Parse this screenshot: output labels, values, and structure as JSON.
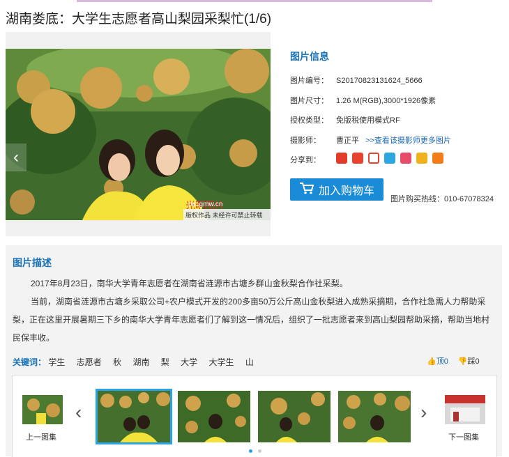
{
  "title": "湖南娄底：大学生志愿者高山梨园采梨忙(1/6)",
  "photo": {
    "watermark_site": "pic.gmw.cn",
    "copyright_note": "版权作品  未经许可禁止转载"
  },
  "info": {
    "heading": "图片信息",
    "id_label": "图片编号：",
    "id_value": "S20170823131624_5666",
    "size_label": "图片尺寸：",
    "size_value": "1.26 M(RGB),3000*1926像素",
    "license_label": "授权类型：",
    "license_value": "免版税使用模式RF",
    "photographer_label": "摄影师：",
    "photographer_value": "曹正平",
    "photographer_link": ">>查看该摄影师更多图片",
    "share_label": "分享到："
  },
  "cart_button": "加入购物车",
  "hotline": "图片购买热线：010-67078324",
  "description": {
    "heading": "图片描述",
    "paragraphs": [
      "2017年8月23日，南华大学青年志愿者在湖南省涟源市古塘乡群山金秋梨合作社采梨。",
      "当前，湖南省涟源市古塘乡采取公司+农户模式开发的200多亩50万公斤高山金秋梨进入成熟采摘期，合作社急需人力帮助采梨，正在这里开展暑期三下乡的南华大学青年志愿者们了解到这一情况后，组织了一批志愿者来到高山梨园帮助采摘，帮助当地村民保丰收。"
    ]
  },
  "keywords": {
    "label": "关键词：",
    "items": [
      "学生",
      "志愿者",
      "秋",
      "湖南",
      "梨",
      "大学",
      "大学生",
      "山"
    ]
  },
  "votes": {
    "up": "顶0",
    "down": "踩0"
  },
  "gallery": {
    "prev_set": "上一图集",
    "next_set": "下一图集"
  },
  "colors": {
    "accent": "#1a73b8",
    "button": "#1a8bd6",
    "active_thumb": "#2aa2e6"
  },
  "share_icons": [
    "google-icon",
    "tencent-icon",
    "weibo-icon",
    "qzone-icon",
    "renren-icon",
    "kaixin-icon",
    "douban-icon"
  ]
}
